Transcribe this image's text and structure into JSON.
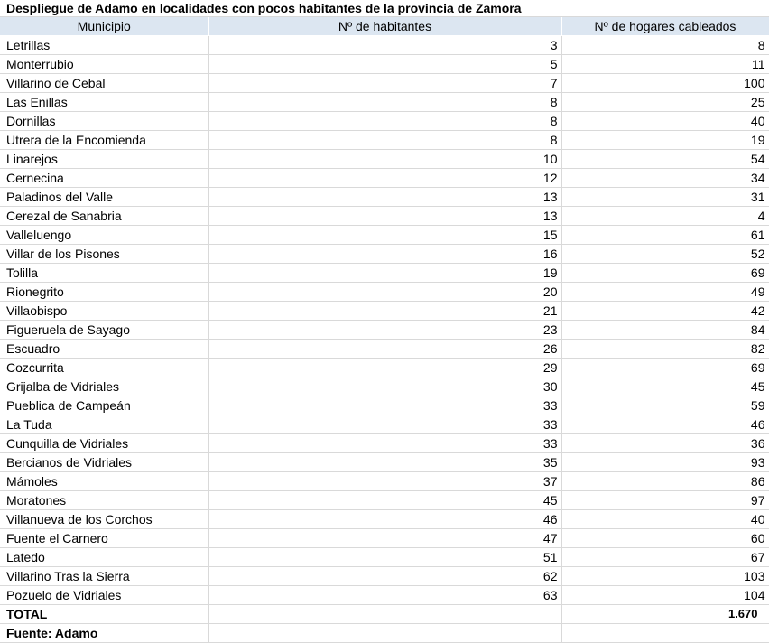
{
  "title": "Despliegue de Adamo en localidades con pocos habitantes de la provincia de Zamora",
  "headers": {
    "municipio": "Municipio",
    "habitantes": "Nº de habitantes",
    "hogares": "Nº de hogares cableados"
  },
  "rows": [
    {
      "municipio": "Letrillas",
      "habitantes": "3",
      "hogares": "8"
    },
    {
      "municipio": "Monterrubio",
      "habitantes": "5",
      "hogares": "11"
    },
    {
      "municipio": "Villarino de Cebal",
      "habitantes": "7",
      "hogares": "100"
    },
    {
      "municipio": "Las Enillas",
      "habitantes": "8",
      "hogares": "25"
    },
    {
      "municipio": "Dornillas",
      "habitantes": "8",
      "hogares": "40"
    },
    {
      "municipio": "Utrera de la Encomienda",
      "habitantes": "8",
      "hogares": "19"
    },
    {
      "municipio": "Linarejos",
      "habitantes": "10",
      "hogares": "54"
    },
    {
      "municipio": "Cernecina",
      "habitantes": "12",
      "hogares": "34"
    },
    {
      "municipio": "Paladinos del Valle",
      "habitantes": "13",
      "hogares": "31"
    },
    {
      "municipio": "Cerezal de Sanabria",
      "habitantes": "13",
      "hogares": "4"
    },
    {
      "municipio": "Valleluengo",
      "habitantes": "15",
      "hogares": "61"
    },
    {
      "municipio": "Villar de los Pisones",
      "habitantes": "16",
      "hogares": "52"
    },
    {
      "municipio": "Tolilla",
      "habitantes": "19",
      "hogares": "69"
    },
    {
      "municipio": "Rionegrito",
      "habitantes": "20",
      "hogares": "49"
    },
    {
      "municipio": "Villaobispo",
      "habitantes": "21",
      "hogares": "42"
    },
    {
      "municipio": "Figueruela de Sayago",
      "habitantes": "23",
      "hogares": "84"
    },
    {
      "municipio": "Escuadro",
      "habitantes": "26",
      "hogares": "82"
    },
    {
      "municipio": "Cozcurrita",
      "habitantes": "29",
      "hogares": "69"
    },
    {
      "municipio": "Grijalba de Vidriales",
      "habitantes": "30",
      "hogares": "45"
    },
    {
      "municipio": "Pueblica de Campeán",
      "habitantes": "33",
      "hogares": "59"
    },
    {
      "municipio": "La Tuda",
      "habitantes": "33",
      "hogares": "46"
    },
    {
      "municipio": "Cunquilla de Vidriales",
      "habitantes": "33",
      "hogares": "36"
    },
    {
      "municipio": "Bercianos de Vidriales",
      "habitantes": "35",
      "hogares": "93"
    },
    {
      "municipio": "Mámoles",
      "habitantes": "37",
      "hogares": "86"
    },
    {
      "municipio": "Moratones",
      "habitantes": "45",
      "hogares": "97"
    },
    {
      "municipio": "Villanueva de los Corchos",
      "habitantes": "46",
      "hogares": "40"
    },
    {
      "municipio": "Fuente el Carnero",
      "habitantes": "47",
      "hogares": "60"
    },
    {
      "municipio": "Latedo",
      "habitantes": "51",
      "hogares": "67"
    },
    {
      "municipio": "Villarino Tras la Sierra",
      "habitantes": "62",
      "hogares": "103"
    },
    {
      "municipio": "Pozuelo de Vidriales",
      "habitantes": "63",
      "hogares": "104"
    }
  ],
  "total": {
    "label": "TOTAL",
    "hogares": "1.670"
  },
  "source": "Fuente: Adamo",
  "colors": {
    "header_bg": "#dce6f1",
    "gridline": "#d9d9d9"
  }
}
